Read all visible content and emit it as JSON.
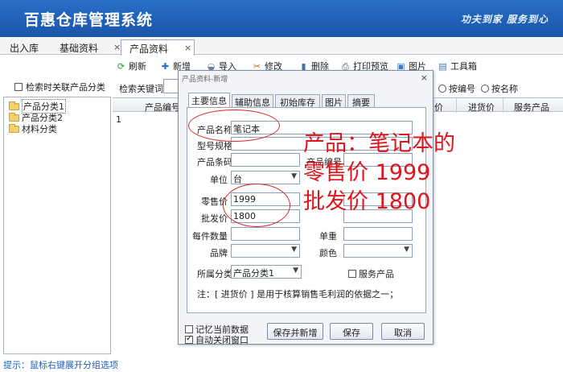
{
  "app": {
    "title": "百惠仓库管理系统",
    "slogan": "功夫到家 服务到心"
  },
  "tabs": [
    {
      "label": "出入库"
    },
    {
      "label": "基础资料"
    },
    {
      "label": "产品资料"
    }
  ],
  "close_glyph": "×",
  "toolbar": {
    "items": [
      {
        "label": "刷新",
        "icon": "refresh-icon"
      },
      {
        "label": "新增",
        "icon": "add-icon"
      },
      {
        "label": "导入",
        "icon": "import-icon"
      },
      {
        "label": "修改",
        "icon": "edit-icon"
      },
      {
        "label": "删除",
        "icon": "delete-icon"
      },
      {
        "label": "打印预览",
        "icon": "print-icon"
      },
      {
        "label": "图片",
        "icon": "image-icon"
      },
      {
        "label": "工具箱",
        "icon": "toolbox-icon"
      }
    ]
  },
  "left": {
    "search_related_label": "检索时关联产品分类",
    "tree": [
      "产品分类1",
      "产品分类2",
      "材料分类"
    ],
    "hint": "提示：鼠标右键展开分组选项"
  },
  "search": {
    "keyword_label": "检索关键词",
    "radio_by_code": "按编号",
    "radio_by_name": "按名称"
  },
  "grid": {
    "columns": [
      "产品编号",
      "价",
      "进货价",
      "服务产品"
    ],
    "rows": [
      {
        "index": "1"
      }
    ]
  },
  "dialog": {
    "title": "产品资料-新增",
    "tabs": [
      "主要信息",
      "辅助信息",
      "初始库存",
      "图片",
      "摘要"
    ],
    "fields": {
      "name_label": "产品名称",
      "name_value": "笔记本",
      "model_label": "型号规格",
      "barcode_label": "产品条码",
      "code_label": "产品编号",
      "unit_label": "单位",
      "unit_value": "台",
      "retail_label": "零售价",
      "retail_value": "1999",
      "wholesale_label": "批发价",
      "wholesale_value": "1800",
      "pack_label": "每件数量",
      "weight_label": "单重",
      "brand_label": "品牌",
      "color_label": "颜色",
      "category_label": "所属分类",
      "category_value": "产品分类1",
      "service_label": "服务产品"
    },
    "note": "注：[ 进货价 ] 是用于核算销售毛利润的依据之一；",
    "remember_label": "记忆当前数据",
    "autoclose_label": "自动关闭窗口",
    "buttons": {
      "save_new": "保存并新增",
      "save": "保存",
      "cancel": "取消"
    }
  },
  "annotations": {
    "line1": "产品：笔记本的",
    "line2": "零售价 1999",
    "line3": "批发价 1800"
  },
  "colors": {
    "banner": "#1f5fb6",
    "annotation": "#e0141d"
  }
}
